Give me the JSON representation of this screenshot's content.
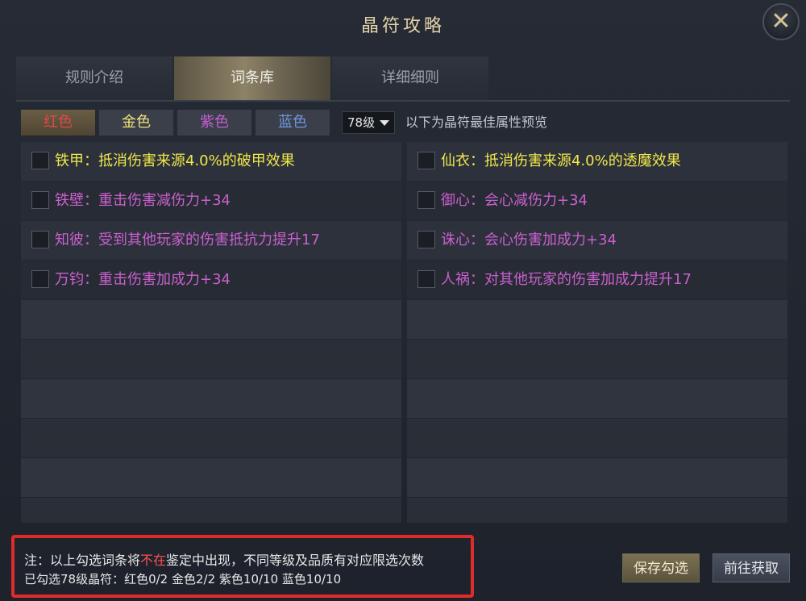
{
  "window": {
    "title": "晶符攻略",
    "close_label": "✕"
  },
  "tabs": [
    {
      "label": "规则介绍",
      "active": false
    },
    {
      "label": "词条库",
      "active": true
    },
    {
      "label": "详细细则",
      "active": false
    }
  ],
  "color_tabs": [
    {
      "label": "红色",
      "color": "#e04848",
      "active": true
    },
    {
      "label": "金色",
      "color": "#f0e07a"
    },
    {
      "label": "紫色",
      "color": "#c45fd6"
    },
    {
      "label": "蓝色",
      "color": "#6f97e0"
    }
  ],
  "level_select": {
    "value": "78级"
  },
  "hint_text": "以下为晶符最佳属性预览",
  "left_entries": [
    {
      "name": "铁甲",
      "desc": "抵消伤害来源4.0%的破甲效果",
      "color": "gold",
      "checked": false
    },
    {
      "name": "铁壁",
      "desc": "重击伤害减伤力+34",
      "color": "purple",
      "checked": false
    },
    {
      "name": "知彼",
      "desc": "受到其他玩家的伤害抵抗力提升17",
      "color": "purple",
      "checked": false
    },
    {
      "name": "万钧",
      "desc": "重击伤害加成力+34",
      "color": "purple",
      "checked": false
    }
  ],
  "right_entries": [
    {
      "name": "仙衣",
      "desc": "抵消伤害来源4.0%的透魔效果",
      "color": "gold",
      "checked": false
    },
    {
      "name": "御心",
      "desc": "会心减伤力+34",
      "color": "purple",
      "checked": false
    },
    {
      "name": "诛心",
      "desc": "会心伤害加成力+34",
      "color": "purple",
      "checked": false
    },
    {
      "name": "人祸",
      "desc": "对其他玩家的伤害加成力提升17",
      "color": "purple",
      "checked": false
    }
  ],
  "note": {
    "prefix": "注：以上勾选词条将",
    "highlight": "不在",
    "suffix": "鉴定中出现，不同等级及品质有对应限选次数",
    "summary": "已勾选78级晶符：红色0/2 金色2/2 紫色10/10 蓝色10/10"
  },
  "buttons": {
    "save": "保存勾选",
    "get": "前往获取"
  }
}
